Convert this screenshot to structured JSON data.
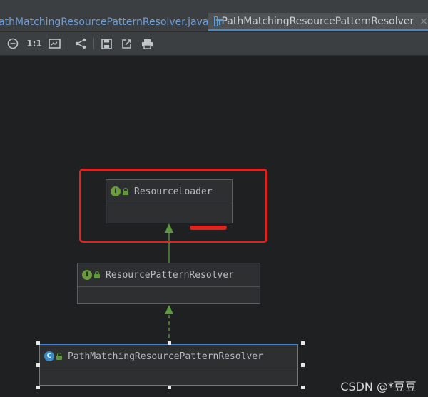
{
  "tabs": [
    {
      "label": "athMatchingResourcePatternResolver.java",
      "active": false
    },
    {
      "label": "PathMatchingResourcePatternResolver",
      "active": true
    }
  ],
  "tab_close_glyph": "×",
  "toolbar": {
    "zoom_out_icon": "minus-circle-icon",
    "actual_size_label": "1:1",
    "fit_icon": "fit-content-icon",
    "layout_icon": "layout-tree-icon",
    "save_icon": "save-icon",
    "export_icon": "export-icon",
    "print_icon": "print-icon"
  },
  "diagram": {
    "nodes": [
      {
        "name": "ResourceLoader",
        "kind": "interface",
        "badge": "I"
      },
      {
        "name": "ResourcePatternResolver",
        "kind": "interface",
        "badge": "I"
      },
      {
        "name": "PathMatchingResourcePatternResolver",
        "kind": "class",
        "badge": "C",
        "selected": true
      }
    ],
    "edges": [
      {
        "from": "ResourcePatternResolver",
        "to": "ResourceLoader",
        "style": "solid"
      },
      {
        "from": "PathMatchingResourcePatternResolver",
        "to": "ResourcePatternResolver",
        "style": "dashed"
      }
    ],
    "annotation_color": "#e0241d"
  },
  "watermark": "CSDN @*豆豆"
}
